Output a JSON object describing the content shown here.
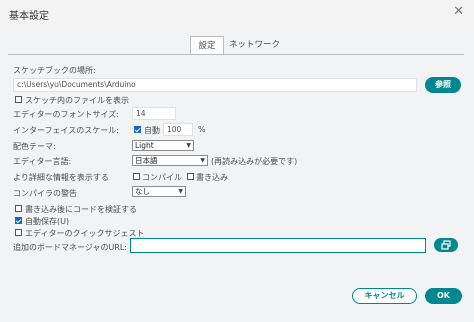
{
  "window": {
    "title": "基本設定",
    "close_glyph": "✕"
  },
  "tabs": [
    {
      "label": "設定",
      "active": true
    },
    {
      "label": "ネットワーク",
      "active": false
    }
  ],
  "sketchbook": {
    "label": "スケッチブックの場所:",
    "path": "c:\\Users\\yu\\Documents\\Arduino",
    "browse_label": "参照"
  },
  "show_files": {
    "label": "スケッチ内のファイルを表示",
    "checked": false
  },
  "editor_font": {
    "label": "エディターのフォントサイズ:",
    "value": "14"
  },
  "interface_scale": {
    "label": "インターフェイスのスケール:",
    "auto_label": "自動",
    "auto_checked": true,
    "value": "100",
    "unit": "%"
  },
  "theme": {
    "label": "配色テーマ:",
    "value": "Light"
  },
  "editor_language": {
    "label": "エディター言語:",
    "value": "日本語",
    "note": "(再読み込みが必要です)"
  },
  "verbose": {
    "label": "より詳細な情報を表示する",
    "compile_label": "コンパイル",
    "compile_checked": false,
    "upload_label": "書き込み",
    "upload_checked": false
  },
  "compiler_warnings": {
    "label": "コンパイラの警告",
    "value": "なし"
  },
  "verify_after_upload": {
    "label": "書き込み後にコードを検証する",
    "checked": false
  },
  "autosave": {
    "label": "自動保存(U)",
    "checked": true
  },
  "quick_suggestions": {
    "label": "エディターのクイックサジェスト",
    "checked": false
  },
  "board_manager": {
    "label": "追加のボードマネージャのURL:",
    "value": ""
  },
  "footer": {
    "cancel_label": "キャンセル",
    "ok_label": "OK"
  },
  "colors": {
    "accent": "#00878f",
    "checkbox_checked": "#1a66c8",
    "panel_bg": "#f1f3f4"
  },
  "icons": {
    "chevron": "chevron-down-icon",
    "url_editor": "open-window-icon"
  }
}
